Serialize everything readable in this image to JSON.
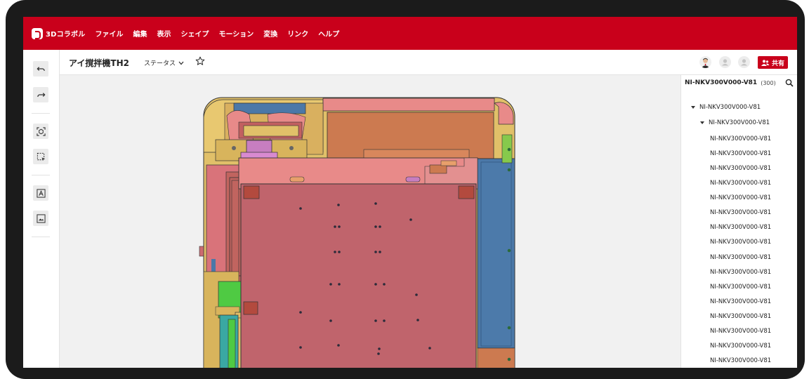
{
  "app": {
    "name": "3Dコラボル"
  },
  "menu": [
    "ファイル",
    "編集",
    "表示",
    "シェイプ",
    "モーション",
    "変換",
    "リンク",
    "ヘルプ"
  ],
  "header": {
    "title": "アイ撹拌機TH2",
    "status_label": "ステータス",
    "share_label": "共有"
  },
  "tools": [
    {
      "name": "undo-icon"
    },
    {
      "name": "redo-icon"
    },
    {
      "name": "fit-view-icon"
    },
    {
      "name": "select-region-icon"
    },
    {
      "name": "text-icon"
    },
    {
      "name": "image-icon"
    }
  ],
  "panel": {
    "title": "NI-NKV300V000-V81",
    "count": "(300)",
    "root": "NI-NKV300V000-V81",
    "child": "NI-NKV300V000-V81",
    "items": [
      "NI-NKV300V000-V81",
      "NI-NKV300V000-V81",
      "NI-NKV300V000-V81",
      "NI-NKV300V000-V81",
      "NI-NKV300V000-V81",
      "NI-NKV300V000-V81",
      "NI-NKV300V000-V81",
      "NI-NKV300V000-V81",
      "NI-NKV300V000-V81",
      "NI-NKV300V000-V81",
      "NI-NKV300V000-V81",
      "NI-NKV300V000-V81",
      "NI-NKV300V000-V81",
      "NI-NKV300V000-V81",
      "NI-NKV300V000-V81",
      "NI-NKV300V000-V81"
    ]
  },
  "colors": {
    "brand": "#c9001b",
    "pink": "#e88a89",
    "rose": "#c0646c",
    "orange": "#cc7a50",
    "blue": "#4b78a8",
    "yellow": "#e1c069",
    "green": "#4fca43",
    "teal": "#3aa8a3"
  }
}
